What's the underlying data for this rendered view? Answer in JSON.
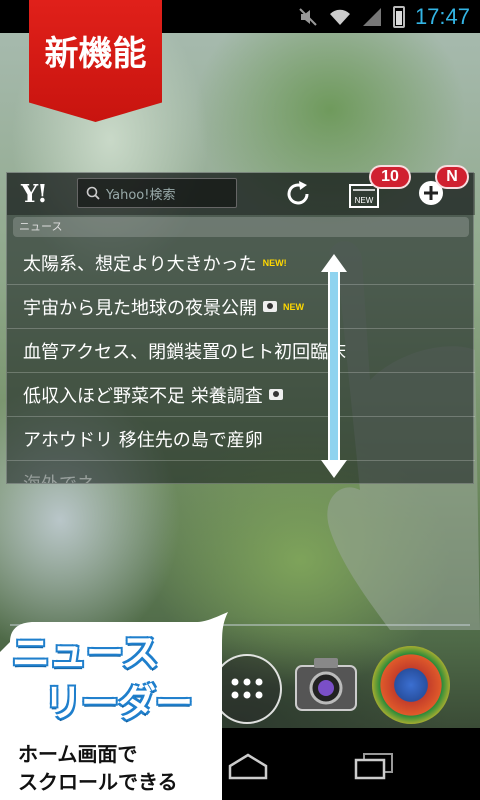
{
  "status_bar": {
    "time": "17:47",
    "icons": [
      "mute-icon",
      "wifi-icon",
      "signal-icon",
      "battery-icon"
    ]
  },
  "promo": {
    "ribbon_text": "新機能",
    "bubble_title_line1": "ニュース",
    "bubble_title_line2": "リーダー",
    "bubble_sub_line1": "ホーム画面で",
    "bubble_sub_line2": "スクロールできる"
  },
  "widget": {
    "logo": "Y!",
    "search_placeholder": "Yahoo!検索",
    "new_icon_label": "NEW",
    "new_badge_count": "10",
    "add_badge": "N",
    "section_label": "ニュース",
    "news_items": [
      {
        "title": "太陽系、想定より大きかった",
        "new": "NEW!",
        "camera": false
      },
      {
        "title": "宇宙から見た地球の夜景公開",
        "new": "NEW",
        "camera": true
      },
      {
        "title": "血管アクセス、閉鎖装置のヒト初回臨床",
        "new": "",
        "camera": false
      },
      {
        "title": "低収入ほど野菜不足 栄養調査",
        "new": "",
        "camera": true
      },
      {
        "title": "アホウドリ 移住先の島で産卵",
        "new": "",
        "camera": false
      },
      {
        "title": "海外でネ...",
        "new": "",
        "camera": false
      }
    ]
  },
  "colors": {
    "accent": "#33b5e5",
    "ribbon": "#e0201a",
    "badge": "#d02030",
    "bubble_blue": "#1f7fcc"
  }
}
